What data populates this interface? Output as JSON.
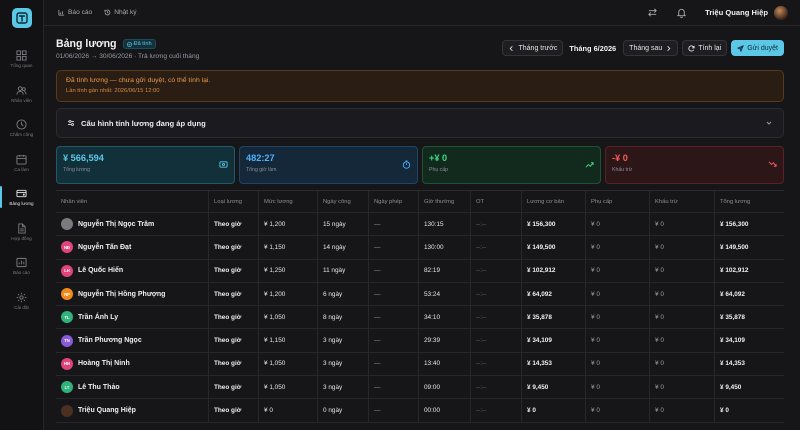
{
  "app": {
    "logo_icon": "t-logo-icon",
    "accent": "#5cc8e8"
  },
  "sidebar": {
    "items": [
      {
        "label": "Tổng quan",
        "icon": "grid-icon",
        "active": false
      },
      {
        "label": "Nhân viên",
        "icon": "users-icon",
        "active": false
      },
      {
        "label": "Chấm công",
        "icon": "clock-icon",
        "active": false
      },
      {
        "label": "Ca làm",
        "icon": "calendar-icon",
        "active": false
      },
      {
        "label": "Bảng lương",
        "icon": "wallet-icon",
        "active": true
      },
      {
        "label": "Hợp đồng",
        "icon": "document-icon",
        "active": false
      },
      {
        "label": "Báo cáo",
        "icon": "chart-icon",
        "active": false
      },
      {
        "label": "Cài đặt",
        "icon": "gear-icon",
        "active": false
      }
    ]
  },
  "topbar": {
    "reports": "Báo cáo",
    "log": "Nhật ký",
    "user_name": "Triệu Quang Hiệp"
  },
  "header": {
    "title": "Bảng lương",
    "status_badge": "Đã tính",
    "subtitle": "01/06/2026 → 30/06/2026 · Trả lương cuối tháng",
    "prev_month": "Tháng trước",
    "period": "Tháng 6/2026",
    "next_month": "Tháng sau",
    "recalc": "Tính lại",
    "submit": "Gửi duyệt"
  },
  "alert": {
    "line1": "Đã tính lương — chưa gửi duyệt, có thể tính lại.",
    "line2": "Lần tính gần nhất: 2026/06/15 12:00"
  },
  "config": {
    "title": "Cấu hình tính lương đang áp dụng"
  },
  "stats": [
    {
      "value": "¥ 566,594",
      "label": "Tổng lương",
      "icon": "wallet-icon",
      "color": "#5cc8e8"
    },
    {
      "value": "482:27",
      "label": "Tổng giờ làm",
      "icon": "timer-icon",
      "color": "#4fb3ff"
    },
    {
      "value": "+¥ 0",
      "label": "Phụ cấp",
      "icon": "trend-up-icon",
      "color": "#3ddc84"
    },
    {
      "value": "-¥ 0",
      "label": "Khấu trừ",
      "icon": "trend-down-icon",
      "color": "#ff5a5a"
    }
  ],
  "table": {
    "columns": [
      "Nhân viên",
      "Loại lương",
      "Mức lương",
      "Ngày công",
      "Ngày phép",
      "Giờ thường",
      "OT",
      "Lương cơ bản",
      "Phụ cấp",
      "Khấu trừ",
      "Tổng lương"
    ],
    "rows": [
      {
        "initials": "",
        "avatar_color": "#7a7a80",
        "name": "Nguyễn Thị Ngọc Trâm",
        "type": "Theo giờ",
        "rate": "¥ 1,200",
        "days": "15 ngày",
        "leave": "—",
        "hours": "130:15",
        "ot": "--:--",
        "base": "¥ 156,300",
        "allow": "¥ 0",
        "deduct": "¥ 0",
        "total": "¥ 156,300"
      },
      {
        "initials": "NĐ",
        "avatar_color": "#e0447a",
        "name": "Nguyễn Tấn Đạt",
        "type": "Theo giờ",
        "rate": "¥ 1,150",
        "days": "14 ngày",
        "leave": "—",
        "hours": "130:00",
        "ot": "--:--",
        "base": "¥ 149,500",
        "allow": "¥ 0",
        "deduct": "¥ 0",
        "total": "¥ 149,500"
      },
      {
        "initials": "LH",
        "avatar_color": "#e0447a",
        "name": "Lê Quốc Hiển",
        "type": "Theo giờ",
        "rate": "¥ 1,250",
        "days": "11 ngày",
        "leave": "—",
        "hours": "82:19",
        "ot": "--:--",
        "base": "¥ 102,912",
        "allow": "¥ 0",
        "deduct": "¥ 0",
        "total": "¥ 102,912"
      },
      {
        "initials": "NP",
        "avatar_color": "#f08a1c",
        "name": "Nguyễn Thị Hồng Phượng",
        "type": "Theo giờ",
        "rate": "¥ 1,200",
        "days": "6 ngày",
        "leave": "—",
        "hours": "53:24",
        "ot": "--:--",
        "base": "¥ 64,092",
        "allow": "¥ 0",
        "deduct": "¥ 0",
        "total": "¥ 64,092"
      },
      {
        "initials": "TL",
        "avatar_color": "#2fb37a",
        "name": "Trần Ánh Ly",
        "type": "Theo giờ",
        "rate": "¥ 1,050",
        "days": "8 ngày",
        "leave": "—",
        "hours": "34:10",
        "ot": "--:--",
        "base": "¥ 35,878",
        "allow": "¥ 0",
        "deduct": "¥ 0",
        "total": "¥ 35,878"
      },
      {
        "initials": "TN",
        "avatar_color": "#8a5ad8",
        "name": "Trần Phương Ngọc",
        "type": "Theo giờ",
        "rate": "¥ 1,150",
        "days": "3 ngày",
        "leave": "—",
        "hours": "29:39",
        "ot": "--:--",
        "base": "¥ 34,109",
        "allow": "¥ 0",
        "deduct": "¥ 0",
        "total": "¥ 34,109"
      },
      {
        "initials": "HN",
        "avatar_color": "#e0447a",
        "name": "Hoàng Thị Ninh",
        "type": "Theo giờ",
        "rate": "¥ 1,050",
        "days": "3 ngày",
        "leave": "—",
        "hours": "13:40",
        "ot": "--:--",
        "base": "¥ 14,353",
        "allow": "¥ 0",
        "deduct": "¥ 0",
        "total": "¥ 14,353"
      },
      {
        "initials": "LT",
        "avatar_color": "#2fb37a",
        "name": "Lê Thu Thảo",
        "type": "Theo giờ",
        "rate": "¥ 1,050",
        "days": "3 ngày",
        "leave": "—",
        "hours": "09:00",
        "ot": "--:--",
        "base": "¥ 9,450",
        "allow": "¥ 0",
        "deduct": "¥ 0",
        "total": "¥ 9,450"
      },
      {
        "initials": "",
        "avatar_color": "#4a3020",
        "name": "Triệu Quang Hiệp",
        "type": "Theo giờ",
        "rate": "¥ 0",
        "days": "0 ngày",
        "leave": "—",
        "hours": "00:00",
        "ot": "--:--",
        "base": "¥ 0",
        "allow": "¥ 0",
        "deduct": "¥ 0",
        "total": "¥ 0"
      }
    ]
  }
}
